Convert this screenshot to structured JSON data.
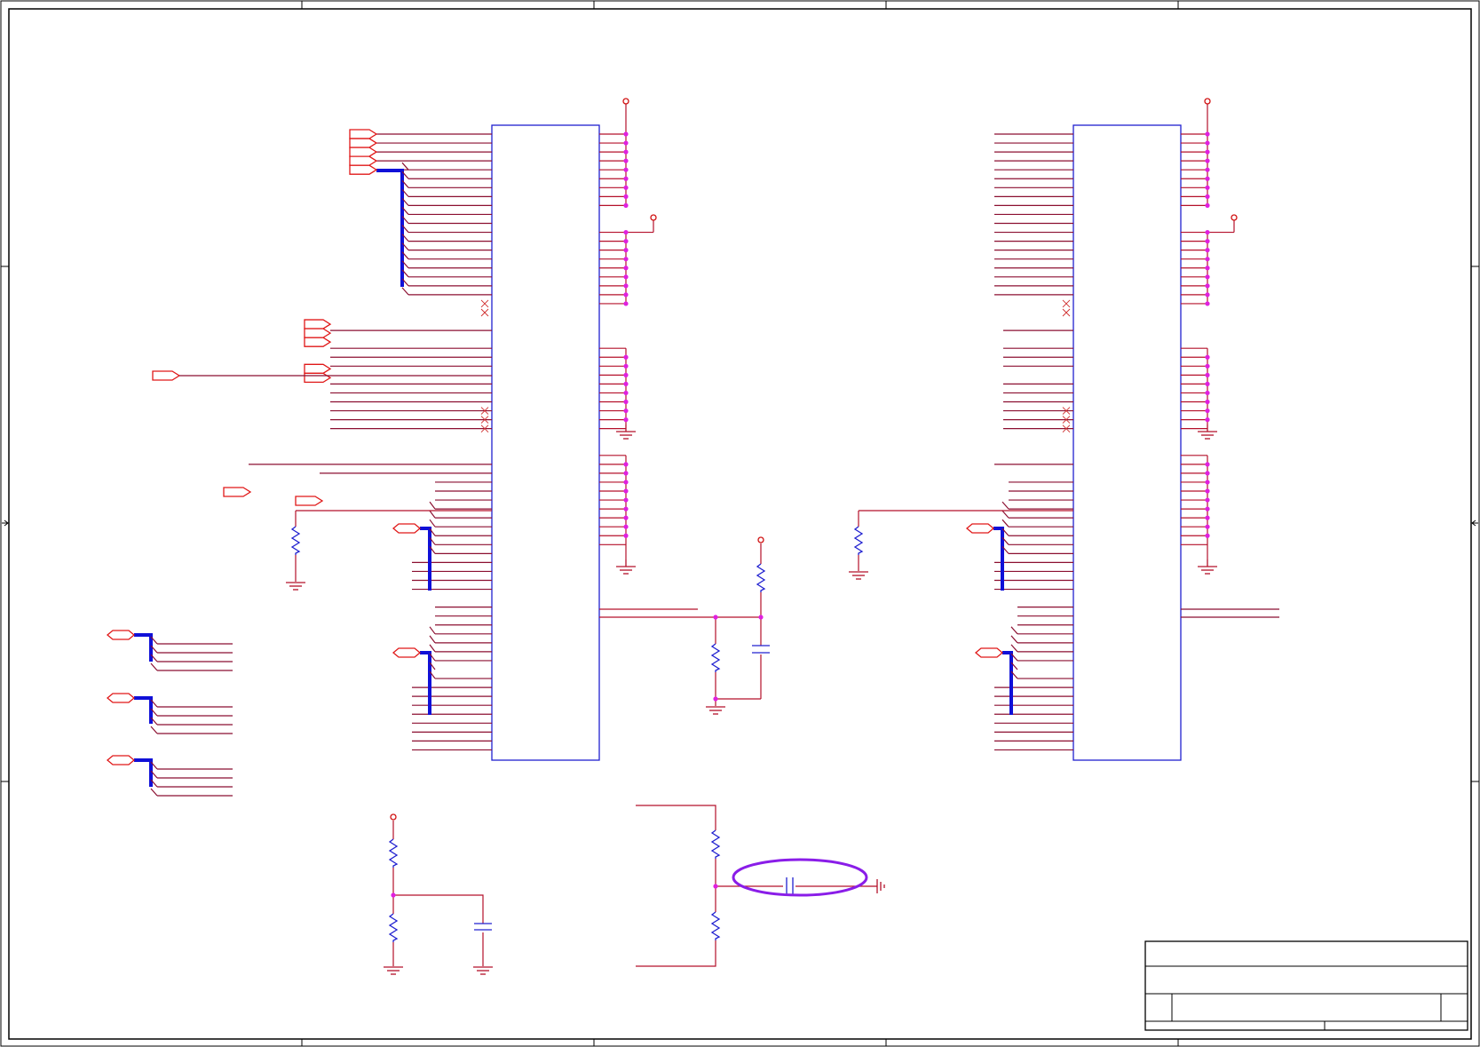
{
  "sheet": {
    "title_block": {
      "title": "",
      "size": "",
      "document_number": "",
      "revision": "",
      "date": "",
      "sheet": ""
    }
  },
  "colors": {
    "net": "#8b0f30",
    "wire": "#b4102a",
    "bus": "#1010d8",
    "component": "#2020d0",
    "junction": "#e020e0",
    "port": "#e01818",
    "highlight": "#8a1de8"
  },
  "icons": {
    "resistor": "resistor-icon",
    "capacitor": "capacitor-icon",
    "ground": "ground-icon",
    "power": "power-port-icon",
    "port": "off-page-connector-icon",
    "no_connect": "no-connect-icon"
  }
}
